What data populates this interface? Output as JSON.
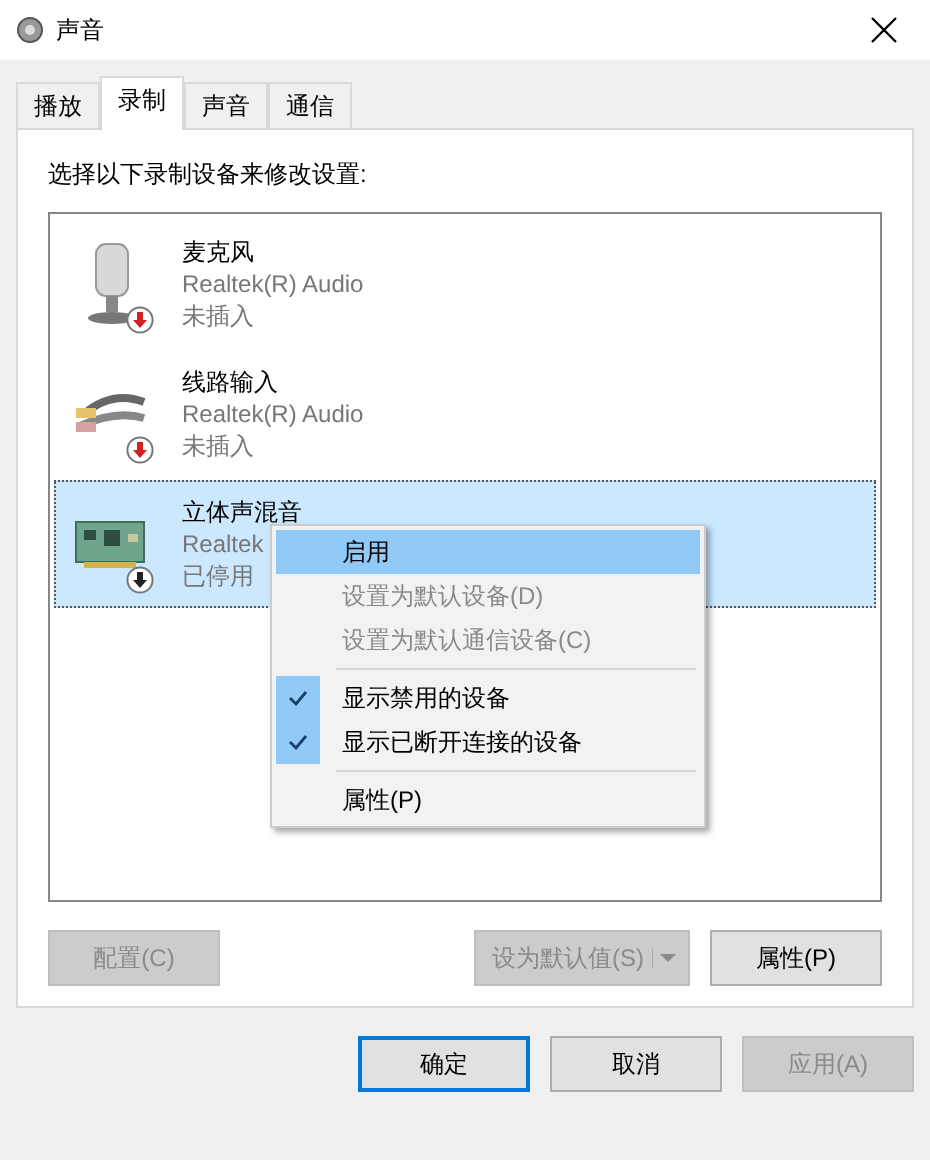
{
  "window": {
    "title": "声音"
  },
  "tabs": [
    {
      "label": "播放",
      "selected": false
    },
    {
      "label": "录制",
      "selected": true
    },
    {
      "label": "声音",
      "selected": false
    },
    {
      "label": "通信",
      "selected": false
    }
  ],
  "instruction": "选择以下录制设备来修改设置:",
  "devices": [
    {
      "kind": "microphone",
      "name": "麦克风",
      "driver": "Realtek(R) Audio",
      "status": "未插入",
      "badge": {
        "color": "#d42020"
      },
      "selected": false
    },
    {
      "kind": "line",
      "name": "线路输入",
      "driver": "Realtek(R) Audio",
      "status": "未插入",
      "badge": {
        "color": "#d42020"
      },
      "selected": false
    },
    {
      "kind": "card",
      "name": "立体声混音",
      "driver": "Realtek",
      "status": "已停用",
      "badge": {
        "color": "#222222"
      },
      "selected": true
    }
  ],
  "context_menu": [
    {
      "kind": "item",
      "label": "启用",
      "selected": true,
      "disabled": false,
      "checked": false
    },
    {
      "kind": "item",
      "label": "设置为默认设备(D)",
      "selected": false,
      "disabled": true,
      "checked": false
    },
    {
      "kind": "item",
      "label": "设置为默认通信设备(C)",
      "selected": false,
      "disabled": true,
      "checked": false
    },
    {
      "kind": "separator"
    },
    {
      "kind": "item",
      "label": "显示禁用的设备",
      "selected": false,
      "disabled": false,
      "checked": true
    },
    {
      "kind": "item",
      "label": "显示已断开连接的设备",
      "selected": false,
      "disabled": false,
      "checked": true
    },
    {
      "kind": "separator"
    },
    {
      "kind": "item",
      "label": "属性(P)",
      "selected": false,
      "disabled": false,
      "checked": false
    }
  ],
  "panel_buttons": [
    {
      "kind": "plain",
      "label": "配置(C)",
      "disabled": true
    },
    {
      "kind": "split",
      "label": "设为默认值(S)",
      "disabled": true
    },
    {
      "kind": "plain",
      "label": "属性(P)",
      "disabled": false
    }
  ],
  "dialog_buttons": [
    {
      "label": "确定",
      "disabled": false,
      "default": true
    },
    {
      "label": "取消",
      "disabled": false,
      "default": false
    },
    {
      "label": "应用(A)",
      "disabled": true,
      "default": false
    }
  ]
}
